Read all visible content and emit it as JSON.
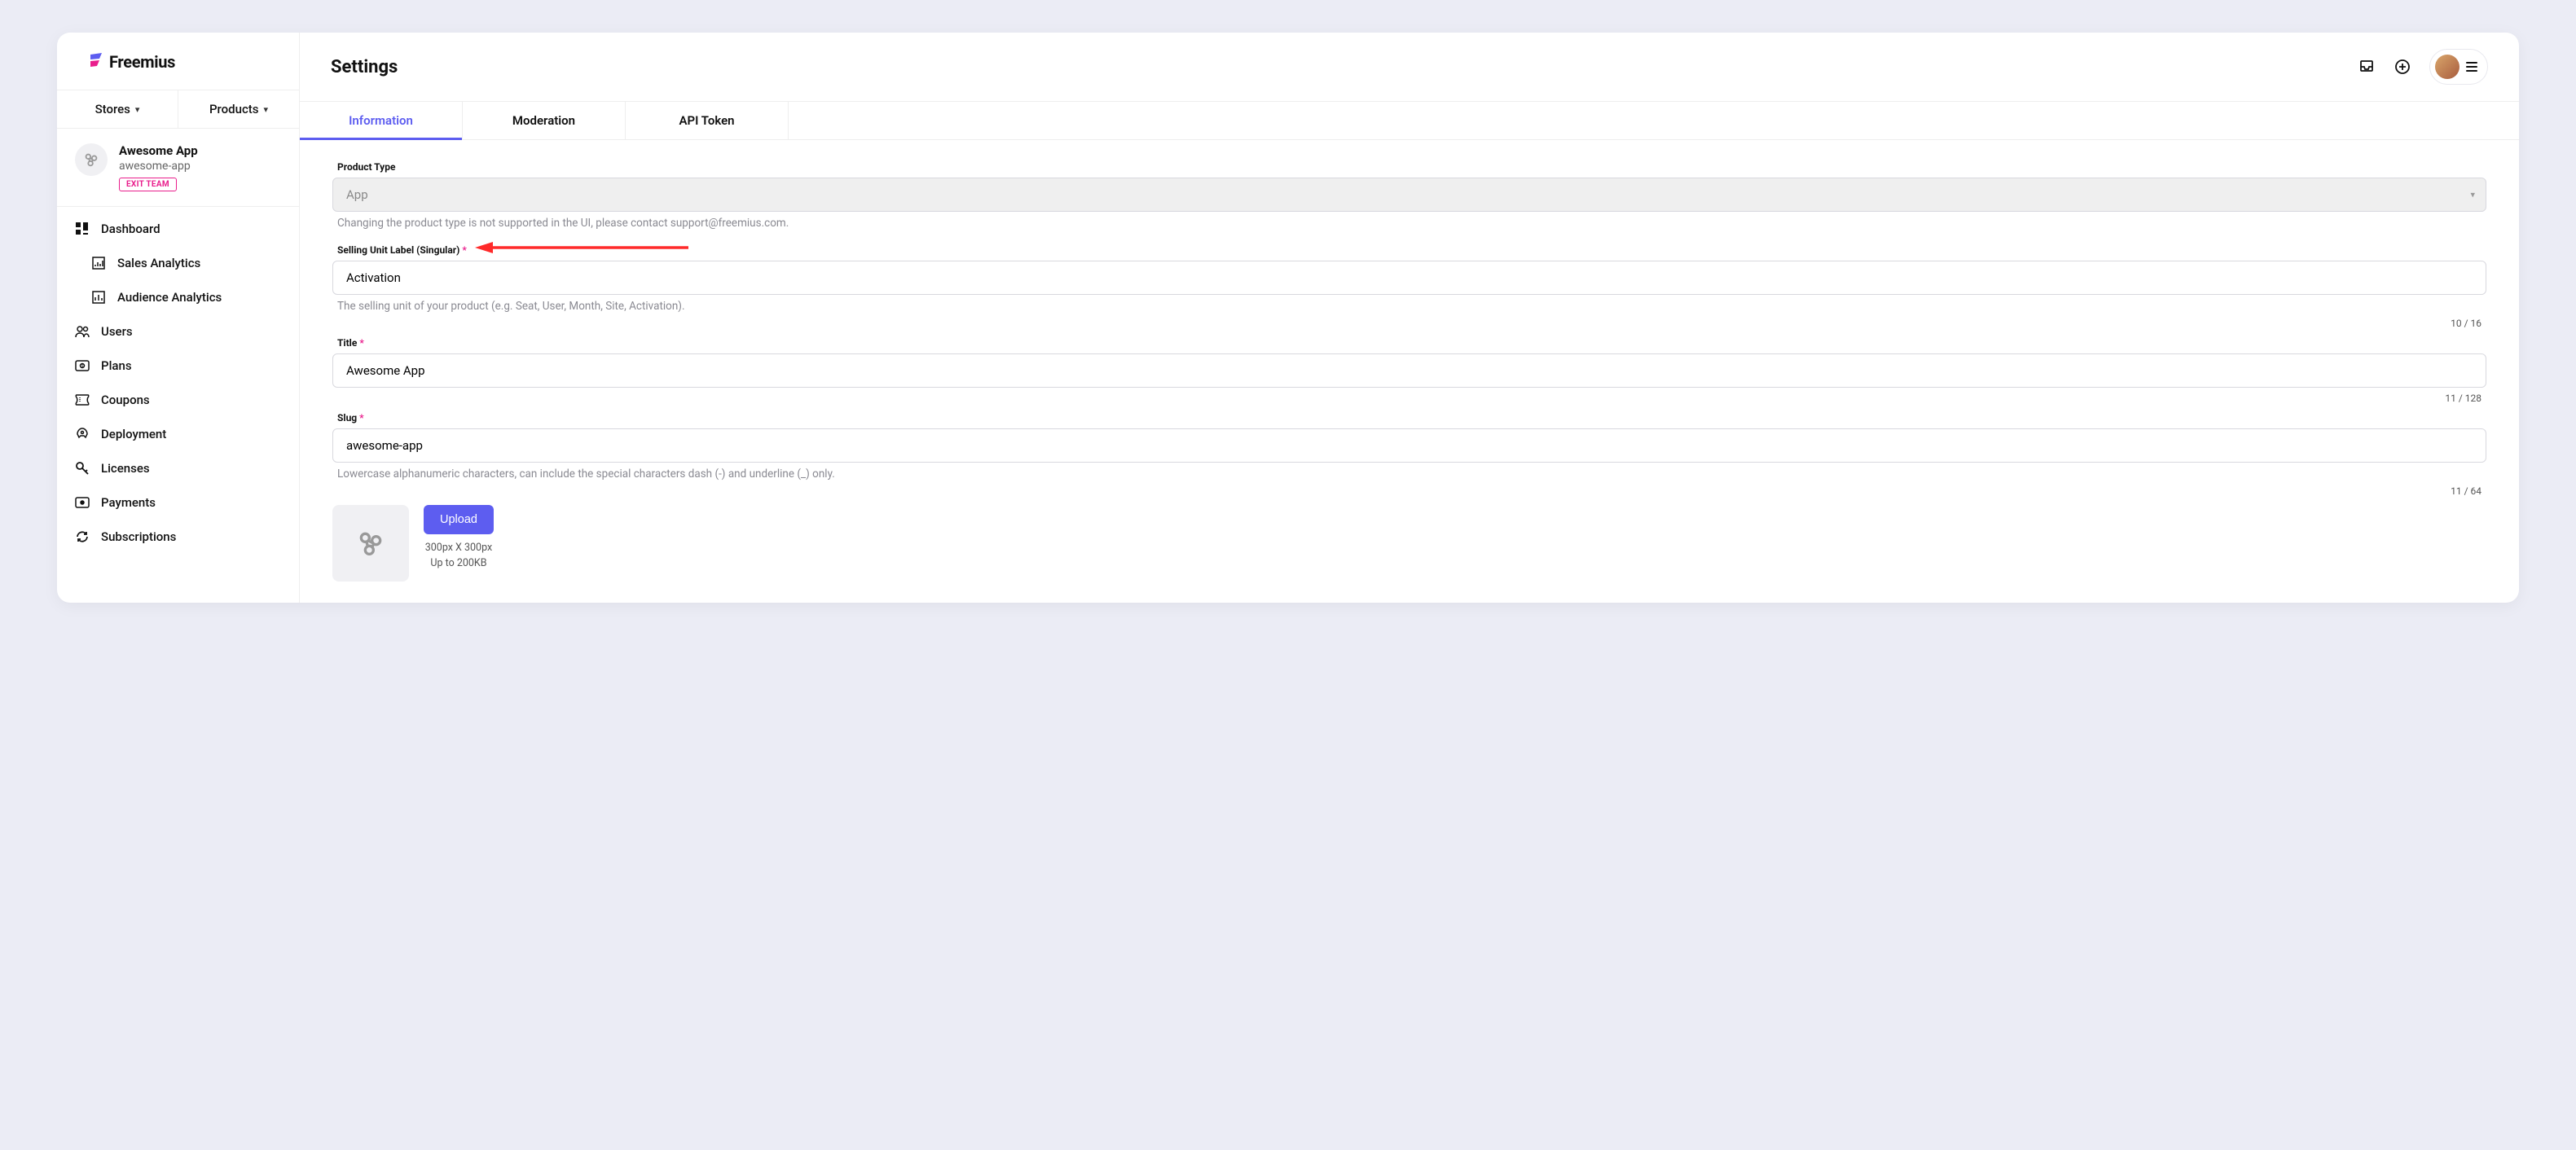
{
  "brand": {
    "name": "Freemius"
  },
  "topnav": {
    "stores": "Stores",
    "products": "Products"
  },
  "team": {
    "name": "Awesome App",
    "slug": "awesome-app",
    "exit_label": "EXIT TEAM"
  },
  "nav": {
    "dashboard": "Dashboard",
    "sales_analytics": "Sales Analytics",
    "audience_analytics": "Audience Analytics",
    "users": "Users",
    "plans": "Plans",
    "coupons": "Coupons",
    "deployment": "Deployment",
    "licenses": "Licenses",
    "payments": "Payments",
    "subscriptions": "Subscriptions"
  },
  "page": {
    "title": "Settings"
  },
  "tabs": {
    "information": "Information",
    "moderation": "Moderation",
    "api_token": "API Token"
  },
  "form": {
    "product_type": {
      "label": "Product Type",
      "value": "App",
      "help": "Changing the product type is not supported in the UI, please contact support@freemius.com."
    },
    "selling_unit": {
      "label": "Selling Unit Label (Singular)",
      "value": "Activation",
      "help": "The selling unit of your product (e.g. Seat, User, Month, Site, Activation).",
      "counter": "10 / 16"
    },
    "title_field": {
      "label": "Title",
      "value": "Awesome App",
      "counter": "11 / 128"
    },
    "slug_field": {
      "label": "Slug",
      "value": "awesome-app",
      "help": "Lowercase alphanumeric characters, can include the special characters dash (-) and underline (_) only.",
      "counter": "11 / 64"
    },
    "upload": {
      "button": "Upload",
      "note1": "300px X 300px",
      "note2": "Up to 200KB"
    }
  }
}
